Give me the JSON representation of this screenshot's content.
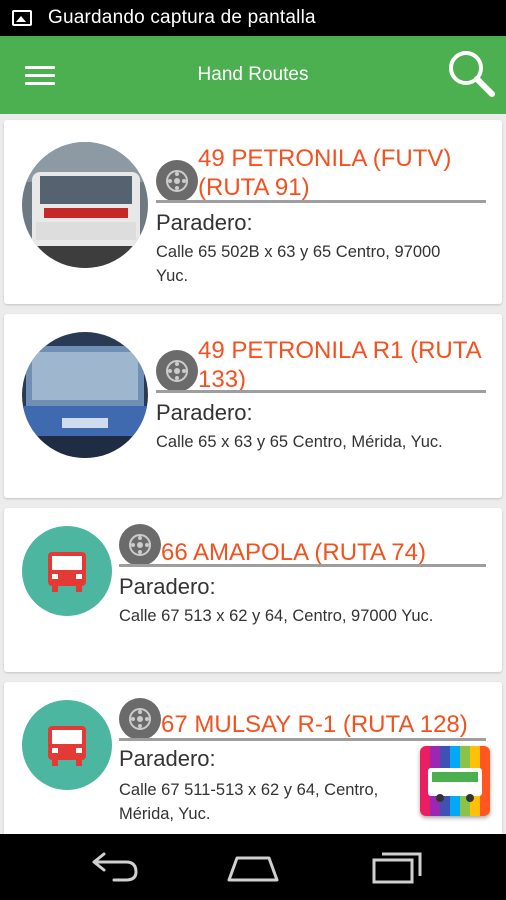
{
  "status_bar": {
    "text": "Guardando captura de pantalla"
  },
  "app_bar": {
    "title": "Hand Routes"
  },
  "colors": {
    "primary": "#4caf50",
    "accent_title": "#f4511e",
    "bus_circle": "#4db6a0"
  },
  "routes": [
    {
      "title": "49 PETRONILA (FUTV) (RUTA 91)",
      "stop_label": "Paradero:",
      "address": "Calle 65 502B x 63 y 65 Centro, 97000 Yuc.",
      "image": "photo"
    },
    {
      "title": "49 PETRONILA R1 (RUTA 133)",
      "stop_label": "Paradero:",
      "address": "Calle 65 x 63 y 65 Centro, Mérida, Yuc.",
      "image": "photo"
    },
    {
      "title": "66 AMAPOLA (RUTA 74)",
      "stop_label": "Paradero:",
      "address": "Calle 67 513 x 62 y 64, Centro, 97000 Yuc.",
      "image": "bus-icon"
    },
    {
      "title": "67 MULSAY R-1 (RUTA 128)",
      "stop_label": "Paradero:",
      "address": "Calle 67 511-513 x 62 y 64, Centro, Mérida, Yuc.",
      "image": "bus-icon"
    }
  ],
  "icons": {
    "menu": "menu-icon",
    "search": "search-icon",
    "route_badge": "wheel-icon",
    "nav_back": "back-icon",
    "nav_home": "home-icon",
    "nav_recents": "recents-icon"
  }
}
